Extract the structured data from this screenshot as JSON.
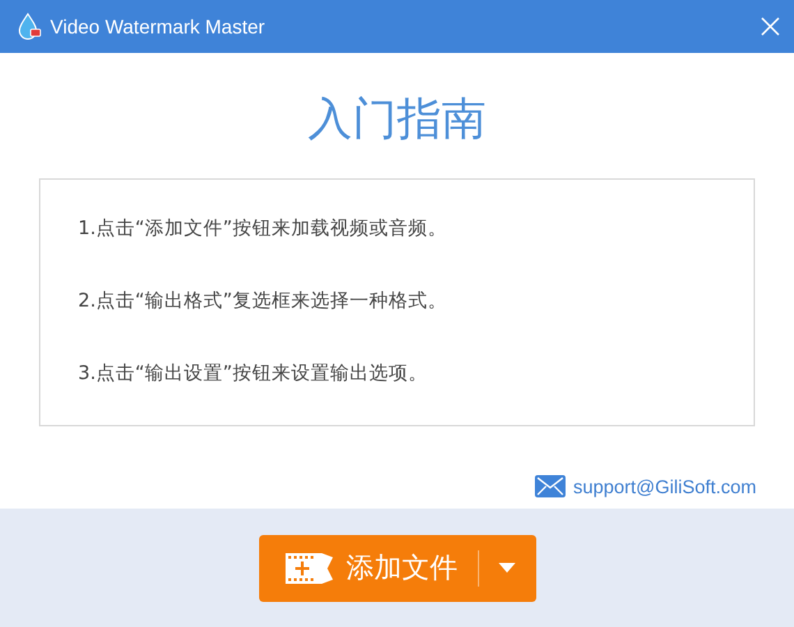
{
  "window": {
    "title": "Video Watermark Master"
  },
  "heading": "入门指南",
  "steps": [
    "1.点击“添加文件”按钮来加载视频或音频。",
    "2.点击“输出格式”复选框来选择一种格式。",
    "3.点击“输出设置”按钮来设置输出选项。"
  ],
  "support_email": "support@GiliSoft.com",
  "add_button": {
    "label": "添加文件"
  }
}
